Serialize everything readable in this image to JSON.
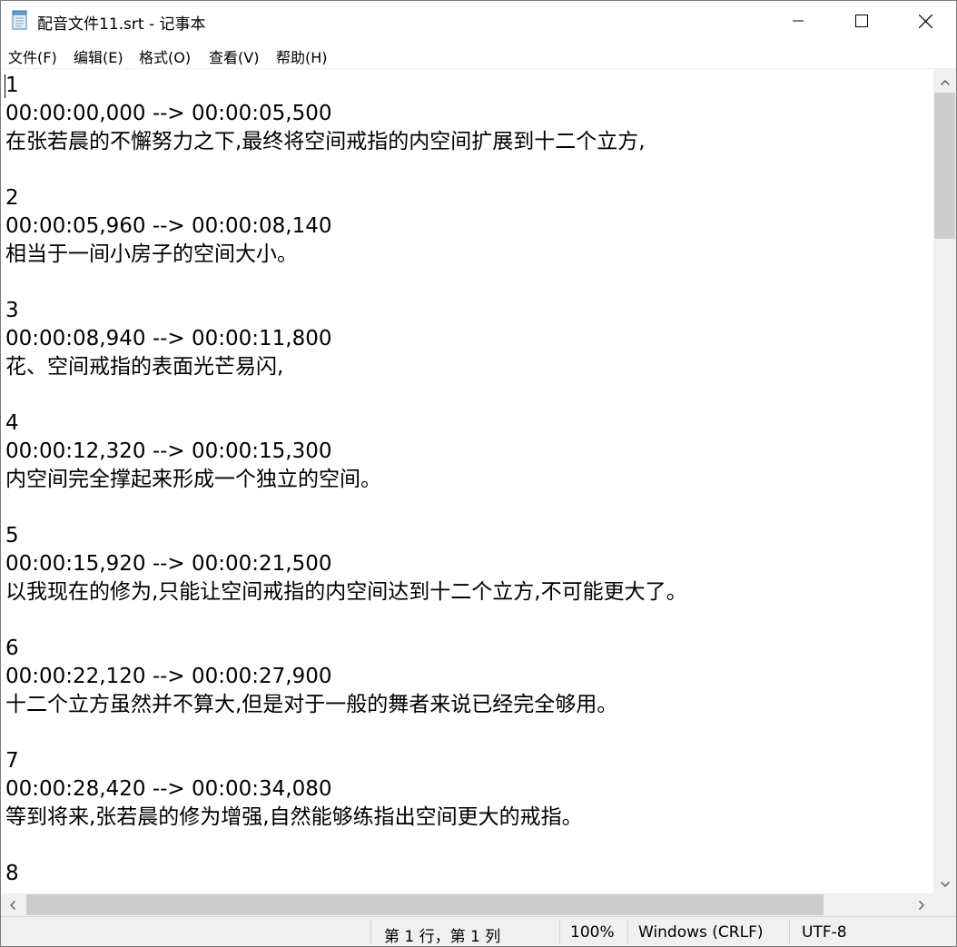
{
  "window": {
    "title": "配音文件11.srt - 记事本"
  },
  "menu": [
    {
      "label": "文件(F)"
    },
    {
      "label": "编辑(E)"
    },
    {
      "label": "格式(O)"
    },
    {
      "label": "查看(V)"
    },
    {
      "label": "帮助(H)"
    }
  ],
  "editor": {
    "lines": [
      "1",
      "00:00:00,000 --> 00:00:05,500",
      "在张若晨的不懈努力之下,最终将空间戒指的内空间扩展到十二个立方,",
      "",
      "2",
      "00:00:05,960 --> 00:00:08,140",
      "相当于一间小房子的空间大小。",
      "",
      "3",
      "00:00:08,940 --> 00:00:11,800",
      "花、空间戒指的表面光芒易闪,",
      "",
      "4",
      "00:00:12,320 --> 00:00:15,300",
      "内空间完全撑起来形成一个独立的空间。",
      "",
      "5",
      "00:00:15,920 --> 00:00:21,500",
      "以我现在的修为,只能让空间戒指的内空间达到十二个立方,不可能更大了。",
      "",
      "6",
      "00:00:22,120 --> 00:00:27,900",
      "十二个立方虽然并不算大,但是对于一般的舞者来说已经完全够用。",
      "",
      "7",
      "00:00:28,420 --> 00:00:34,080",
      "等到将来,张若晨的修为增强,自然能够练指出空间更大的戒指。",
      "",
      "8"
    ]
  },
  "status": {
    "position": "第 1 行，第 1 列",
    "zoom": "100%",
    "line_ending": "Windows (CRLF)",
    "encoding": "UTF-8"
  },
  "icons": {
    "app": "notepad-icon",
    "minimize": "minimize-icon",
    "maximize": "maximize-icon",
    "close": "close-icon"
  }
}
